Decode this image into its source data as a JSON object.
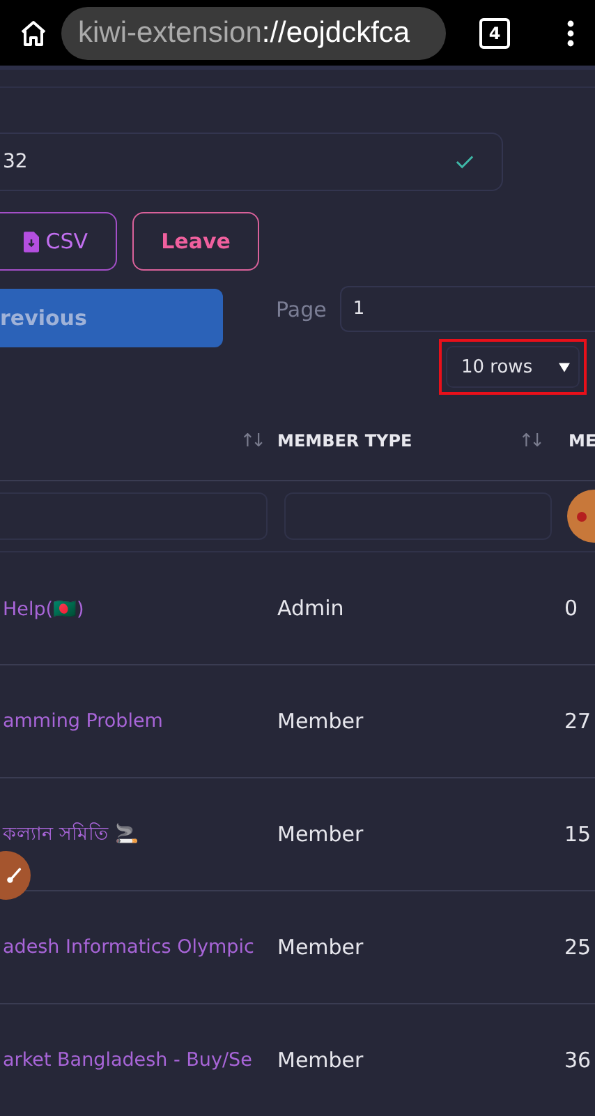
{
  "browser": {
    "url_scheme": "kiwi-extension",
    "url_rest": "://eojdckfca",
    "tab_count": "4"
  },
  "search": {
    "value": "32",
    "valid": true
  },
  "actions": [
    {
      "kind": "csv",
      "label": "CSV"
    },
    {
      "kind": "leave",
      "label": "Leave"
    }
  ],
  "pager": {
    "previous": "revious",
    "page_label": "Page",
    "page_value": "1",
    "rows": "10 rows",
    "rows_highlighted": true
  },
  "table": {
    "columns": [
      {
        "sort": "↑↓"
      },
      {
        "label": "MEMBER TYPE",
        "sort": "↑↓"
      },
      {
        "label": "ME"
      }
    ],
    "rows": [
      {
        "group": "Help(🇧🇩)",
        "member_type": "Admin",
        "column_3": "0"
      },
      {
        "group": "amming Problem",
        "member_type": "Member",
        "column_3": "27"
      },
      {
        "group": "কল্যান সমিতি 🚬",
        "member_type": "Member",
        "column_3": "15"
      },
      {
        "group": "adesh Informatics Olympic",
        "member_type": "Member",
        "column_3": "25"
      },
      {
        "group": "arket Bangladesh - Buy/Se",
        "member_type": "Member",
        "column_3": "36"
      }
    ]
  }
}
